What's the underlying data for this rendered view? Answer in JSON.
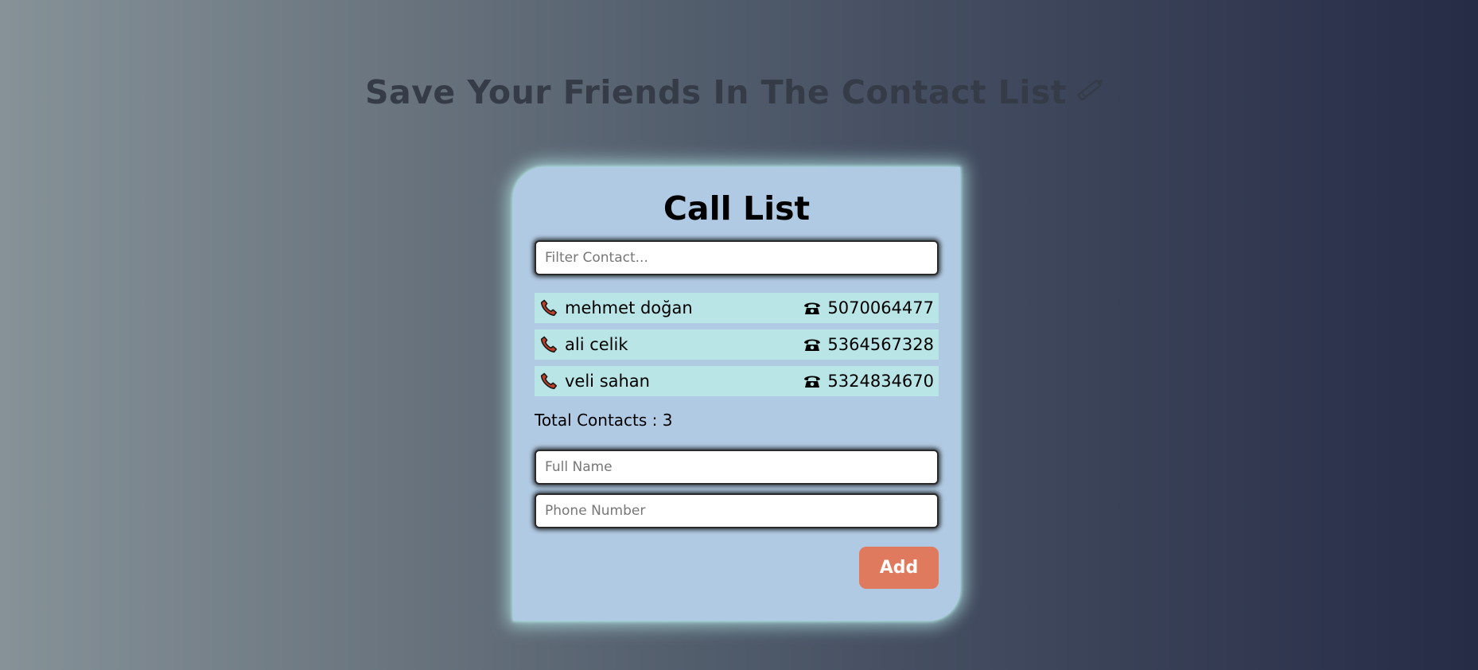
{
  "page": {
    "headline": "Save Your Friends In The Contact List",
    "headline_icon": "pencil-icon"
  },
  "card": {
    "title": "Call List",
    "filter_placeholder": "Filter Contact...",
    "contacts": [
      {
        "name": "mehmet doğan",
        "phone": "5070064477"
      },
      {
        "name": "ali celik",
        "phone": "5364567328"
      },
      {
        "name": "veli sahan",
        "phone": "5324834670"
      }
    ],
    "contact_icon": "telephone-receiver-icon",
    "phone_icon": "telephone-icon",
    "total_label": "Total Contacts : 3",
    "fullname_placeholder": "Full Name",
    "phone_placeholder": "Phone Number",
    "add_label": "Add"
  },
  "colors": {
    "card_background": "#b1cae3",
    "row_background": "#b9e5e6",
    "button": "#e07a5f",
    "headline": "#353c47",
    "glow": "#b9eeee"
  }
}
